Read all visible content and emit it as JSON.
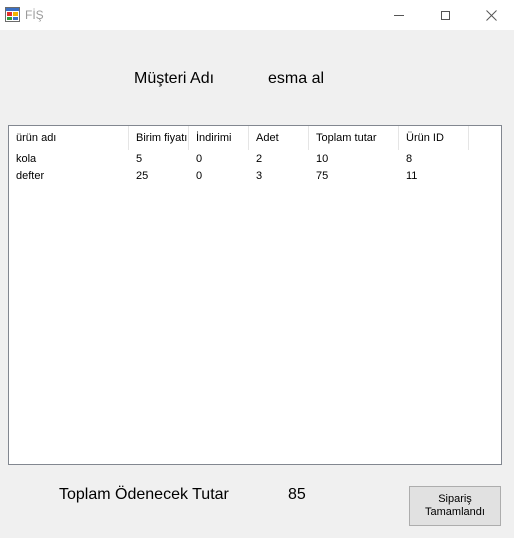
{
  "window": {
    "title": "FİŞ"
  },
  "customer": {
    "label": "Müşteri Adı",
    "value": "esma al"
  },
  "table": {
    "columns": [
      "ürün adı",
      "Birim fiyatı",
      "İndirimi",
      "Adet",
      "Toplam tutar",
      "Ürün ID"
    ],
    "rows": [
      [
        "kola",
        "5",
        "0",
        "2",
        "10",
        "8"
      ],
      [
        "defter",
        "25",
        "0",
        "3",
        "75",
        "11"
      ]
    ]
  },
  "summary": {
    "total_label": "Toplam Ödenecek Tutar",
    "total_value": "85"
  },
  "actions": {
    "complete_line1": "Sipariş",
    "complete_line2": "Tamamlandı"
  }
}
